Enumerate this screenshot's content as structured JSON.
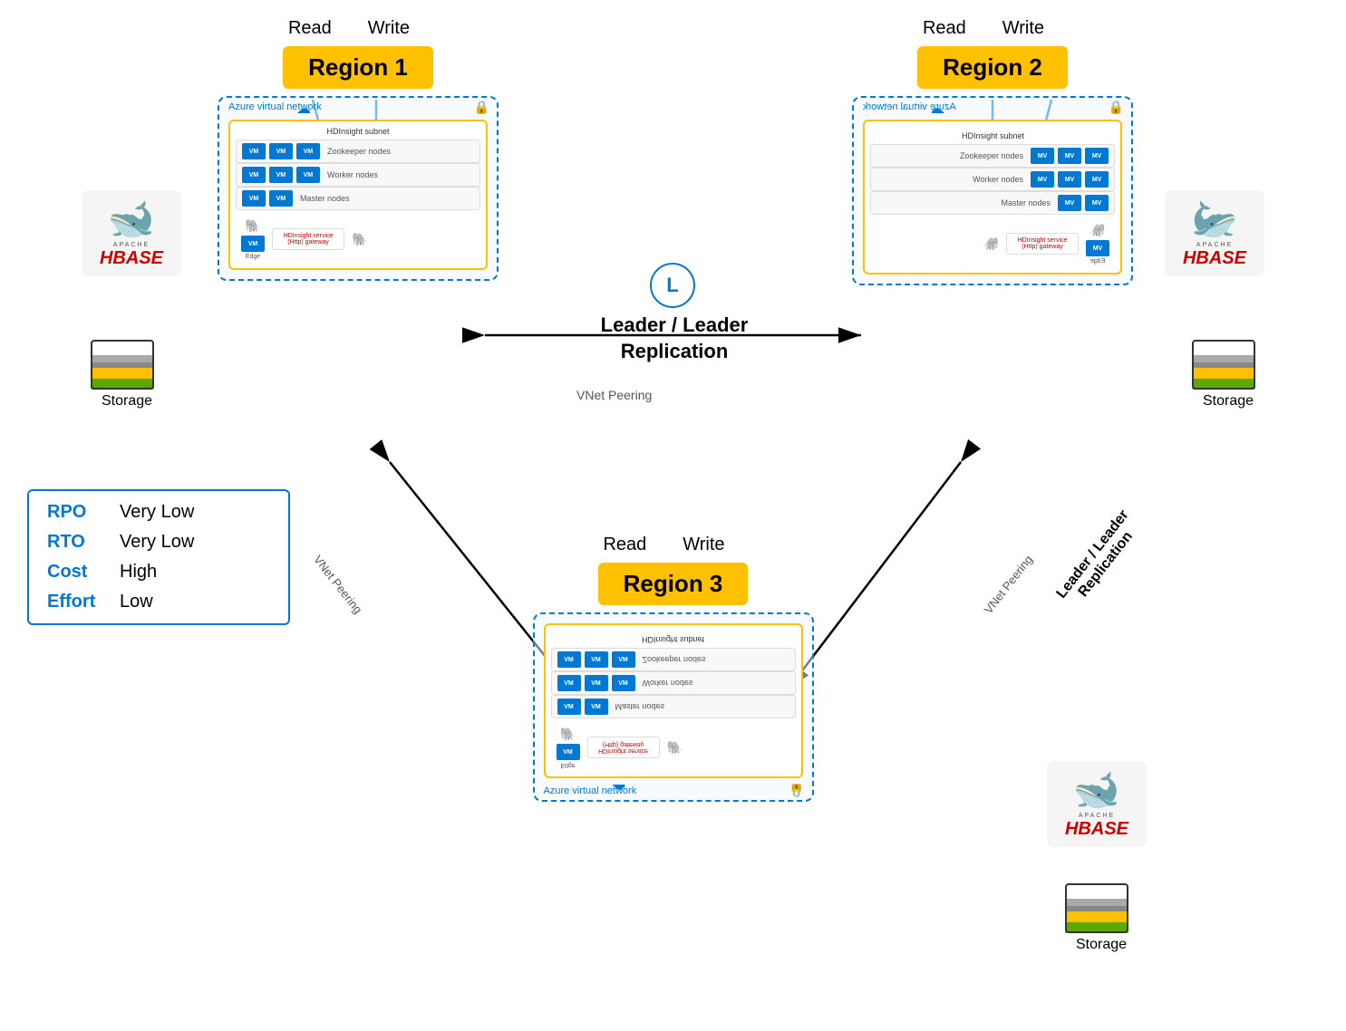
{
  "regions": {
    "region1": {
      "label": "Region 1"
    },
    "region2": {
      "label": "Region 2"
    },
    "region3": {
      "label": "Region 3"
    }
  },
  "cluster": {
    "vnet_label": "Azure virtual network",
    "subnet_label": "HDInsight subnet",
    "zookeeper": "Zookeeper nodes",
    "worker": "Worker nodes",
    "master": "Master nodes",
    "edge": "Edge node",
    "gateway": "HDInsight service (Http) gateway",
    "vm": "VM"
  },
  "replication": {
    "center_label": "Leader / Leader\nReplication",
    "left_label": "Leader / Leader\nReplication",
    "right_label": "Leader / Leader\nReplication",
    "vnet_peering_center": "VNet Peering",
    "vnet_peering_left": "VNet Peering",
    "vnet_peering_right": "VNet Peering",
    "circle_l": "L"
  },
  "read_write": {
    "region1_read": "Read",
    "region1_write": "Write",
    "region2_read": "Read",
    "region2_write": "Write",
    "region3_read": "Read",
    "region3_write": "Write"
  },
  "info_box": {
    "rpo_label": "RPO",
    "rpo_value": "Very Low",
    "rto_label": "RTO",
    "rto_value": "Very Low",
    "cost_label": "Cost",
    "cost_value": "High",
    "effort_label": "Effort",
    "effort_value": "Low"
  },
  "storage": {
    "label": "Storage"
  },
  "hbase": {
    "apache": "APACHE",
    "hbase": "HBASE"
  }
}
